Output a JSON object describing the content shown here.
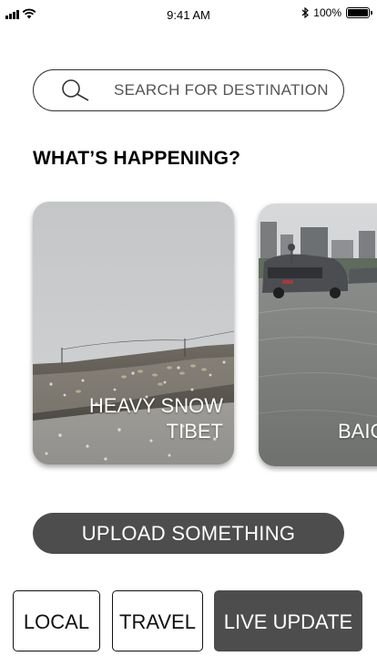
{
  "status_bar": {
    "time": "9:41 AM",
    "battery_text": "100%",
    "battery_level": 1.0,
    "icons": [
      "signal-icon",
      "wifi-icon",
      "bluetooth-icon",
      "battery-icon"
    ]
  },
  "search": {
    "placeholder": "SEARCH FOR DESTINATION",
    "icon": "search-icon"
  },
  "section": {
    "title": "WHAT’S HAPPENING?"
  },
  "cards": [
    {
      "caption_line1": "HEAVY SNOW",
      "caption_line2": "TIBET",
      "image": "snowy-hillside-with-goats"
    },
    {
      "caption_line1": "BAIC",
      "caption_line2": "",
      "image": "flooded-street-with-cars"
    }
  ],
  "upload": {
    "label": "UPLOAD SOMETHING"
  },
  "tabs": [
    {
      "label": "LOCAL",
      "active": false
    },
    {
      "label": "TRAVEL",
      "active": false
    },
    {
      "label": "LIVE UPDATE",
      "active": true
    }
  ],
  "colors": {
    "primary_dark": "#4d4d4d",
    "background": "#ffffff",
    "text": "#000000"
  }
}
